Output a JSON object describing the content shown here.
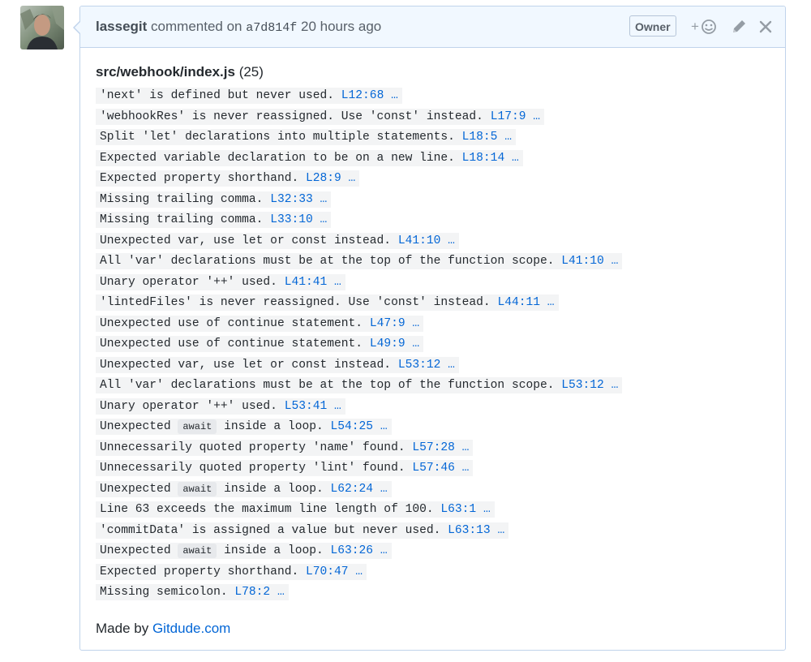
{
  "comment": {
    "author": "lassegit",
    "action": "commented on",
    "commit_sha": "a7d814f",
    "time": "20 hours ago",
    "badge": "Owner",
    "reaction_plus": "+"
  },
  "file": {
    "path": "src/webhook/index.js",
    "count": "(25)"
  },
  "messages": [
    {
      "pre": "'next' is defined but never used.",
      "loc": "L12:68"
    },
    {
      "pre": "'webhookRes' is never reassigned. Use 'const' instead.",
      "loc": "L17:9"
    },
    {
      "pre": "Split 'let' declarations into multiple statements.",
      "loc": "L18:5"
    },
    {
      "pre": "Expected variable declaration to be on a new line.",
      "loc": "L18:14"
    },
    {
      "pre": "Expected property shorthand.",
      "loc": "L28:9"
    },
    {
      "pre": "Missing trailing comma.",
      "loc": "L32:33"
    },
    {
      "pre": "Missing trailing comma.",
      "loc": "L33:10"
    },
    {
      "pre": "Unexpected var, use let or const instead.",
      "loc": "L41:10"
    },
    {
      "pre": "All 'var' declarations must be at the top of the function scope.",
      "loc": "L41:10"
    },
    {
      "pre": "Unary operator '++' used.",
      "loc": "L41:41"
    },
    {
      "pre": "'lintedFiles' is never reassigned. Use 'const' instead.",
      "loc": "L44:11"
    },
    {
      "pre": "Unexpected use of continue statement.",
      "loc": "L47:9"
    },
    {
      "pre": "Unexpected use of continue statement.",
      "loc": "L49:9"
    },
    {
      "pre": "Unexpected var, use let or const instead.",
      "loc": "L53:12"
    },
    {
      "pre": "All 'var' declarations must be at the top of the function scope.",
      "loc": "L53:12"
    },
    {
      "pre": "Unary operator '++' used.",
      "loc": "L53:41"
    },
    {
      "pre": "Unexpected",
      "code": "await",
      "post": "inside a loop.",
      "loc": "L54:25"
    },
    {
      "pre": "Unnecessarily quoted property 'name' found.",
      "loc": "L57:28"
    },
    {
      "pre": "Unnecessarily quoted property 'lint' found.",
      "loc": "L57:46"
    },
    {
      "pre": "Unexpected",
      "code": "await",
      "post": "inside a loop.",
      "loc": "L62:24"
    },
    {
      "pre": "Line 63 exceeds the maximum line length of 100.",
      "loc": "L63:1"
    },
    {
      "pre": "'commitData' is assigned a value but never used.",
      "loc": "L63:13"
    },
    {
      "pre": "Unexpected",
      "code": "await",
      "post": "inside a loop.",
      "loc": "L63:26"
    },
    {
      "pre": "Expected property shorthand.",
      "loc": "L70:47"
    },
    {
      "pre": "Missing semicolon.",
      "loc": "L78:2"
    }
  ],
  "ellipsis": "…",
  "footer": {
    "prefix": "Made by",
    "link_text": "Gitdude.com"
  },
  "colors": {
    "header_bg": "#f1f8ff",
    "border": "#c0d3eb",
    "link": "#0366d6",
    "code_bg": "#f3f4f5"
  }
}
